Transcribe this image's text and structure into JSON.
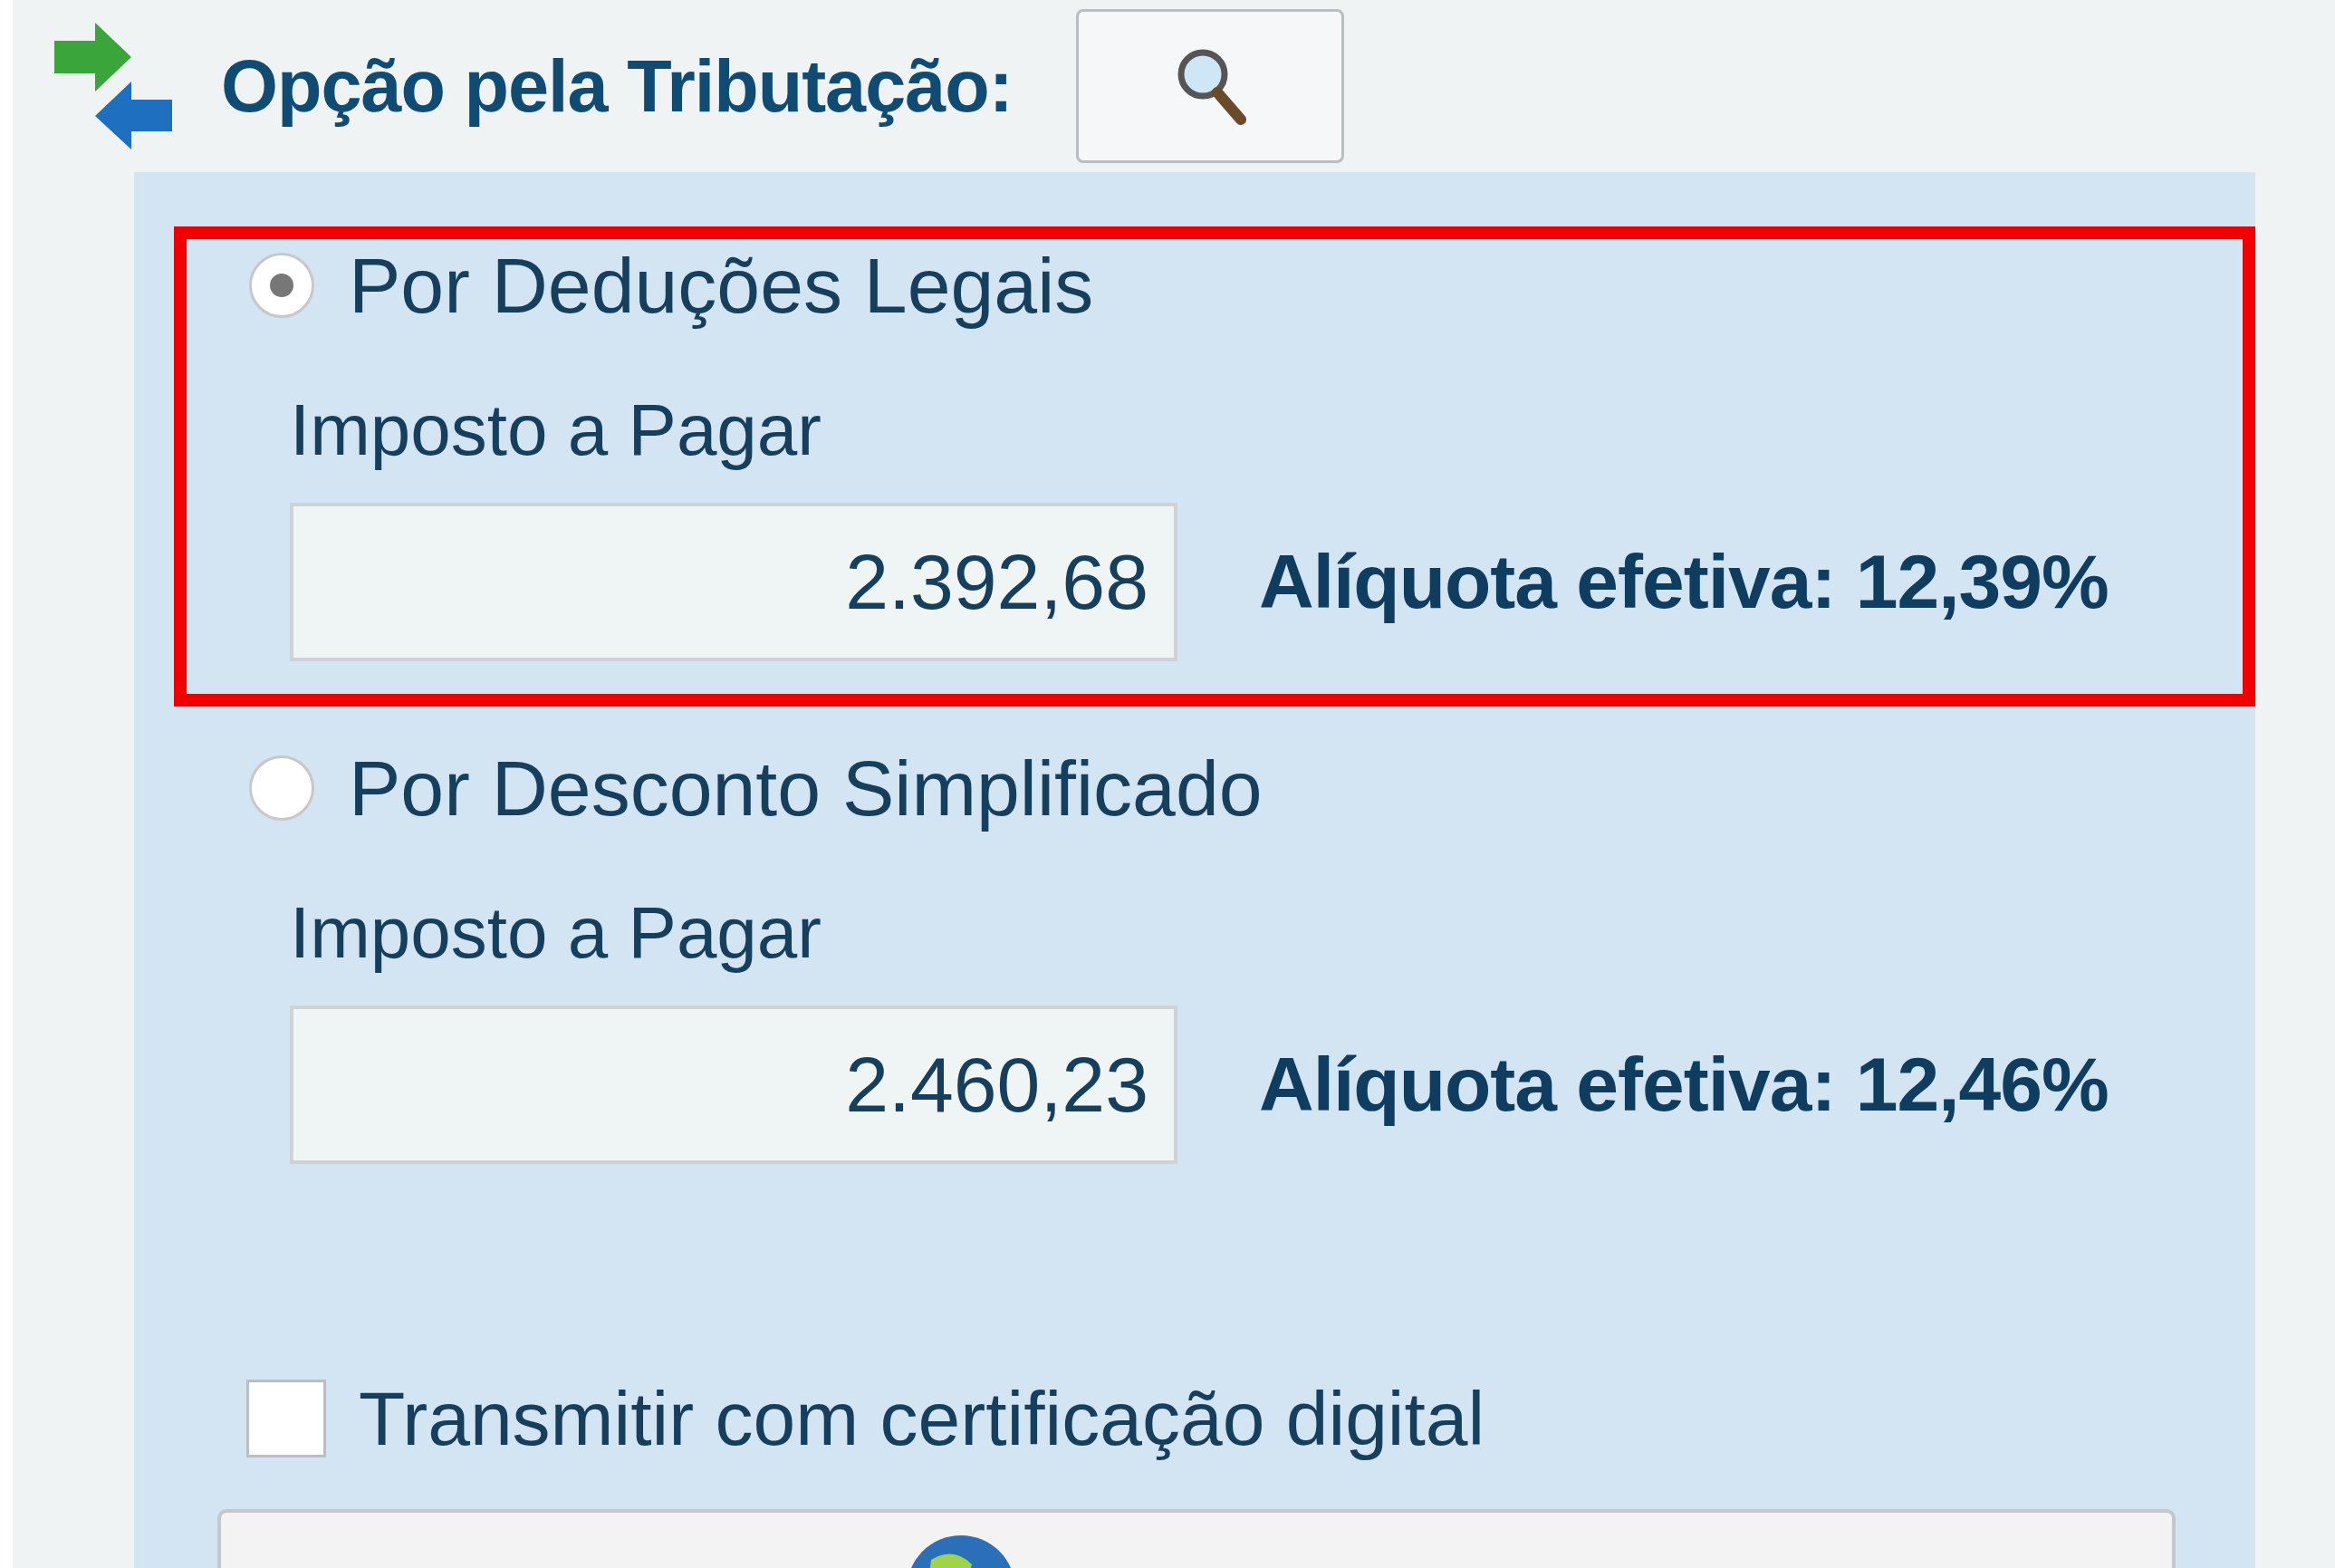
{
  "header": {
    "title": "Opção pela Tributação:"
  },
  "options": [
    {
      "label": "Por Deduções Legais",
      "selected": true,
      "highlighted": true,
      "field": {
        "label": "Imposto a Pagar",
        "value": "2.392,68"
      },
      "rate": "Alíquota efetiva: 12,39%"
    },
    {
      "label": "Por Desconto Simplificado",
      "selected": false,
      "highlighted": false,
      "field": {
        "label": "Imposto a Pagar",
        "value": "2.460,23"
      },
      "rate": "Alíquota efetiva: 12,46%"
    }
  ],
  "certificate": {
    "label": "Transmitir com certificação digital",
    "checked": false
  }
}
